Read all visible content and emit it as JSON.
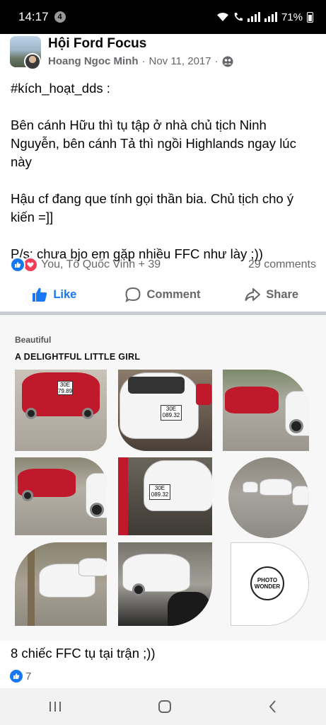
{
  "status": {
    "time": "14:17",
    "notification_count": "4",
    "battery": "71%"
  },
  "post": {
    "group_name": "Hội Ford Focus",
    "author": "Hoang Ngoc Minh",
    "separator": "·",
    "date": "Nov 11, 2017",
    "paragraphs": [
      "#kích_hoạt_dds :",
      "Bên cánh Hữu thì tụ tập ở nhà chủ tịch Ninh Nguyễn, bên cánh Tả thì ngồi Highlands ngay lúc này",
      "Hậu cf đang que tính gọi thần bia. Chủ tịch cho ý kiến =]]",
      "P/s: chưa bjo em gặp nhiều FFC như lày ;))"
    ],
    "reactions_text": "You, Tô Quốc Vinh + 39",
    "comments": "29 comments",
    "actions": {
      "like": "Like",
      "comment": "Comment",
      "share": "Share"
    }
  },
  "collage": {
    "subtitle": "Beautiful",
    "title": "A DELIGHTFUL LITTLE GIRL",
    "plates": [
      "30E\n089.32",
      "30E\n089.32"
    ],
    "stamp_lines": [
      "PHOTO",
      "WONDER"
    ]
  },
  "post2": {
    "text": "8 chiếc FFC tụ tại trận ;))",
    "reaction_count": "7"
  },
  "icons": {
    "like": "thumbs-up-icon",
    "comment": "speech-bubble-icon",
    "share": "share-arrow-icon",
    "audience": "group-members-icon"
  },
  "colors": {
    "facebook_blue": "#1877f2",
    "love_red": "#f33e58",
    "secondary_text": "#65676b"
  }
}
